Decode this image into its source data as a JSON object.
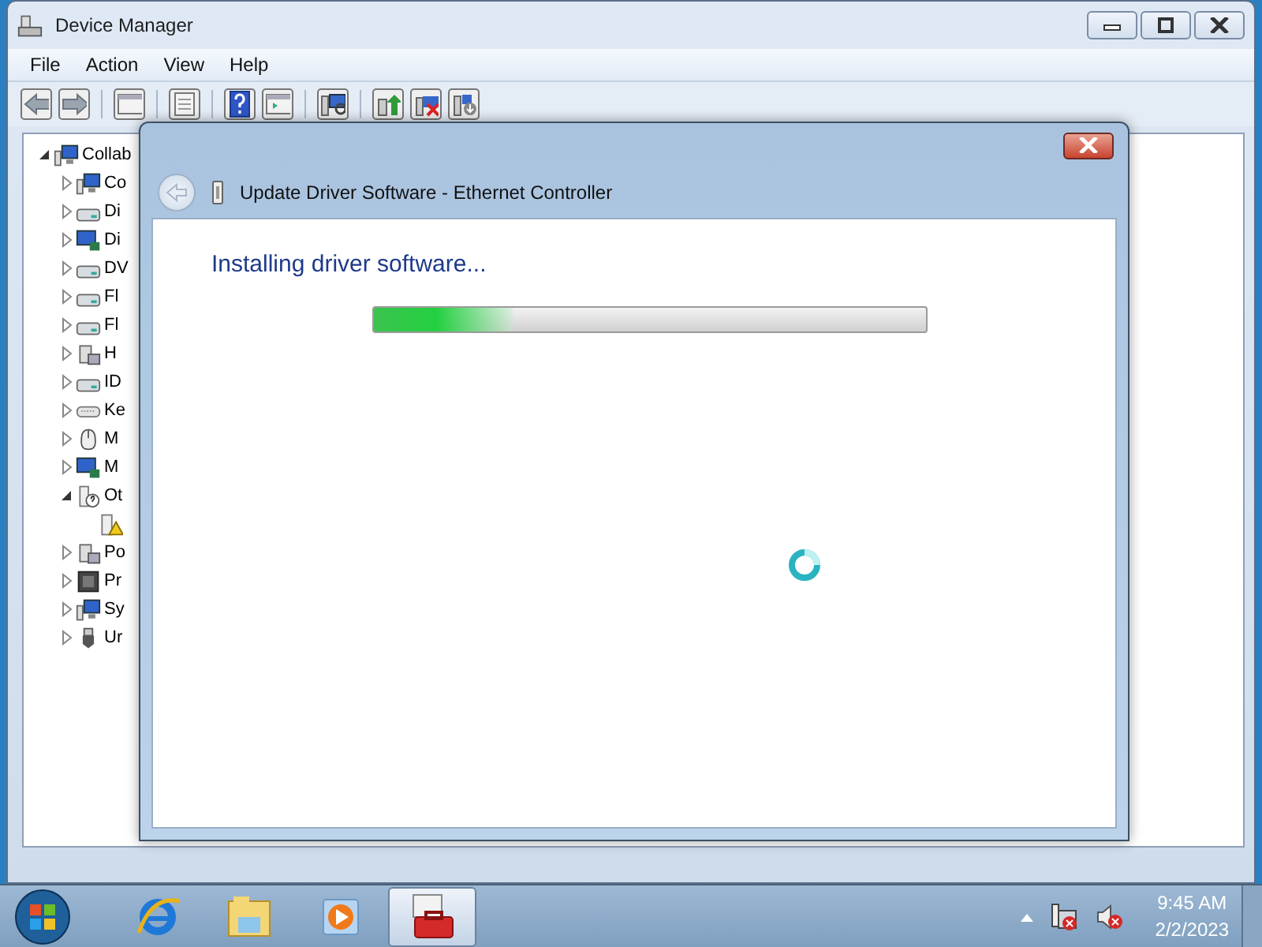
{
  "window": {
    "title": "Device Manager"
  },
  "menu": [
    "File",
    "Action",
    "View",
    "Help"
  ],
  "tree": {
    "label": "Collab",
    "kind": "computer",
    "expanded": true,
    "children": [
      {
        "label": "Co",
        "kind": "computer",
        "expanded": false
      },
      {
        "label": "Di",
        "kind": "drive",
        "expanded": false
      },
      {
        "label": "Di",
        "kind": "display",
        "expanded": false
      },
      {
        "label": "DV",
        "kind": "drive",
        "expanded": false
      },
      {
        "label": "Fl",
        "kind": "drive",
        "expanded": false
      },
      {
        "label": "Fl",
        "kind": "drive",
        "expanded": false
      },
      {
        "label": "H",
        "kind": "device",
        "expanded": false
      },
      {
        "label": "ID",
        "kind": "drive",
        "expanded": false
      },
      {
        "label": "Ke",
        "kind": "keyboard",
        "expanded": false
      },
      {
        "label": "M",
        "kind": "mouse",
        "expanded": false
      },
      {
        "label": "M",
        "kind": "display",
        "expanded": false
      },
      {
        "label": "Ot",
        "kind": "unknown",
        "expanded": true,
        "children": [
          {
            "kind": "warning"
          }
        ]
      },
      {
        "label": "Po",
        "kind": "device",
        "expanded": false
      },
      {
        "label": "Pr",
        "kind": "chip",
        "expanded": false
      },
      {
        "label": "Sy",
        "kind": "computer",
        "expanded": false
      },
      {
        "label": "Ur",
        "kind": "usb",
        "expanded": false
      }
    ]
  },
  "dialog": {
    "title": "Update Driver Software - Ethernet Controller",
    "heading": "Installing driver software...",
    "progress": {
      "level": 0.25
    }
  },
  "taskbar": {
    "apps": [
      {
        "kind": "ie",
        "selected": false
      },
      {
        "kind": "explorer",
        "selected": false
      },
      {
        "kind": "media",
        "selected": false
      },
      {
        "kind": "toolbox",
        "selected": true
      }
    ],
    "clock": {
      "time": "9:45 AM",
      "date": "2/2/2023"
    }
  }
}
